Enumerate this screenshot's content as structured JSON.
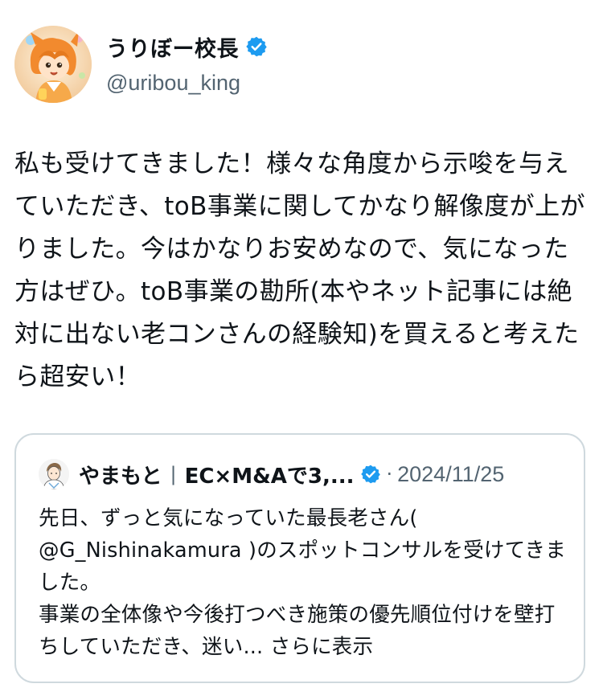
{
  "author": {
    "display_name": "うりぼー校長",
    "handle": "@uribou_king",
    "verified": true,
    "avatar_icon": "illustrated-character-avatar"
  },
  "tweet": {
    "text": "私も受けてきました！様々な角度から示唆を与えていただき、toB事業に関してかなり解像度が上がりました。今はかなりお安めなので、気になった方はぜひ。toB事業の勘所(本やネット記事には絶対に出ない老コンさんの経験知)を買えると考えたら超安い！"
  },
  "quote": {
    "author_name": "やまもと",
    "separator": "|",
    "author_handle": "EC×M&Aで3,...",
    "verified": true,
    "dot": "·",
    "date": "2024/11/25",
    "body": "先日、ずっと気になっていた最長老さん( @G_Nishinakamura )のスポットコンサルを受けてきました。\n事業の全体像や今後打つべき施策の優先順位付けを壁打ちしていただき、迷い...",
    "show_more": "さらに表示"
  },
  "colors": {
    "text": "#0f1419",
    "secondary": "#536471",
    "border": "#cfd9de",
    "verified_blue": "#1d9bf0"
  }
}
